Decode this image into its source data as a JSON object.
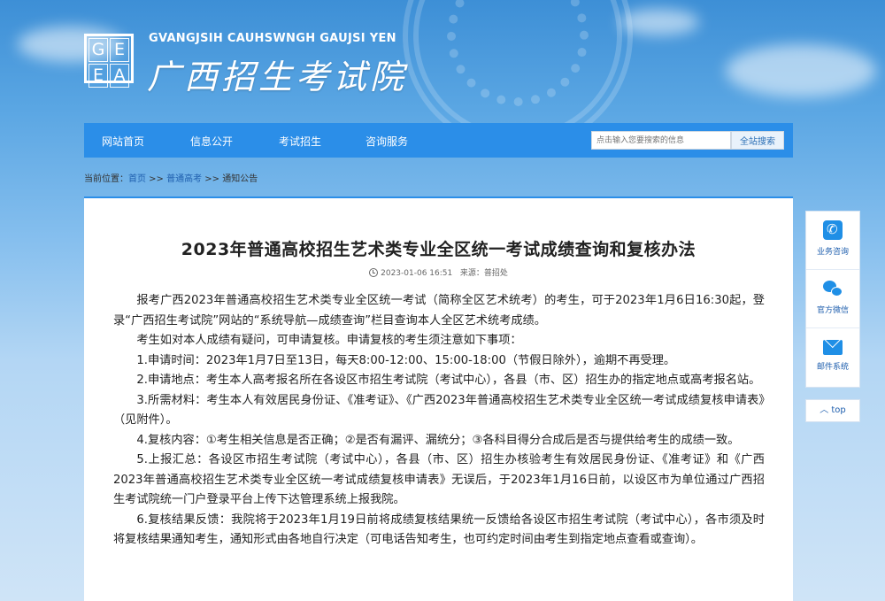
{
  "header": {
    "logo_letters": [
      "G",
      "E",
      "E",
      "A"
    ],
    "site_name_en": "GVANGJSIH CAUHSWNGH GAUJSI YEN",
    "site_name_cn": "广西招生考试院"
  },
  "nav": {
    "items": [
      "网站首页",
      "信息公开",
      "考试招生",
      "咨询服务"
    ],
    "search_placeholder": "点击输入您要搜索的信息",
    "search_button": "全站搜索"
  },
  "breadcrumb": {
    "prefix": "当前位置：",
    "items": [
      "首页",
      "普通高考",
      "通知公告"
    ],
    "separator": " >> "
  },
  "article": {
    "title": "2023年普通高校招生艺术类专业全区统一考试成绩查询和复核办法",
    "datetime": "2023-01-06 16:51",
    "source_label": "来源：",
    "source": "普招处",
    "paragraphs": [
      "报考广西2023年普通高校招生艺术类专业全区统一考试（简称全区艺术统考）的考生，可于2023年1月6日16:30起，登录“广西招生考试院”网站的“系统导航—成绩查询”栏目查询本人全区艺术统考成绩。",
      "考生如对本人成绩有疑问，可申请复核。申请复核的考生须注意如下事项：",
      "1.申请时间：2023年1月7日至13日，每天8:00-12:00、15:00-18:00（节假日除外），逾期不再受理。",
      "2.申请地点：考生本人高考报名所在各设区市招生考试院（考试中心），各县（市、区）招生办的指定地点或高考报名站。",
      "3.所需材料：考生本人有效居民身份证、《准考证》、《广西2023年普通高校招生艺术类专业全区统一考试成绩复核申请表》（见附件）。",
      "4.复核内容：①考生相关信息是否正确；②是否有漏评、漏统分；③各科目得分合成后是否与提供给考生的成绩一致。",
      "5.上报汇总：各设区市招生考试院（考试中心），各县（市、区）招生办核验考生有效居民身份证、《准考证》和《广西2023年普通高校招生艺术类专业全区统一考试成绩复核申请表》无误后，于2023年1月16日前，以设区市为单位通过广西招生考试院统一门户登录平台上传下达管理系统上报我院。",
      "6.复核结果反馈：我院将于2023年1月19日前将成绩复核结果统一反馈给各设区市招生考试院（考试中心），各市须及时将复核结果通知考生，通知形式由各地自行决定（可电话告知考生，也可约定时间由考生到指定地点查看或查询）。"
    ]
  },
  "side": {
    "items": [
      {
        "icon": "phone-icon",
        "label": "业务咨询"
      },
      {
        "icon": "wechat-icon",
        "label": "官方微信"
      },
      {
        "icon": "mail-icon",
        "label": "邮件系统"
      }
    ],
    "top_label": "top"
  },
  "colors": {
    "nav_bg": "#2b8ee8",
    "link": "#1f5fae"
  }
}
